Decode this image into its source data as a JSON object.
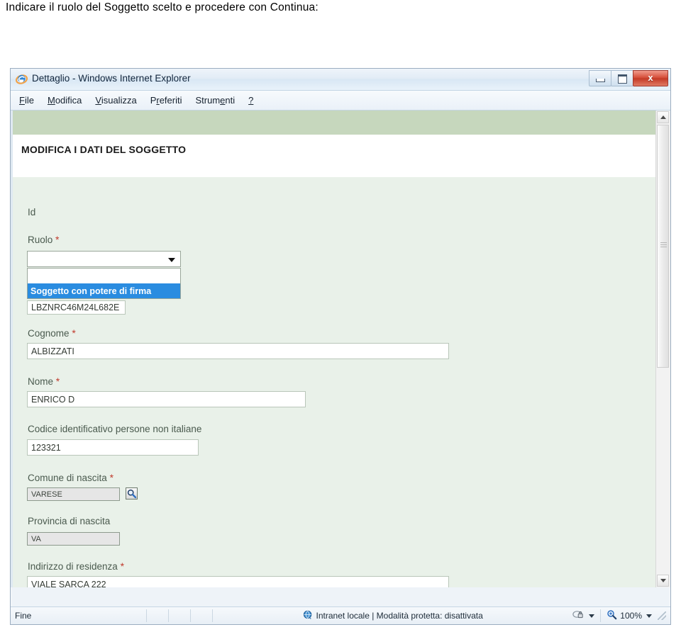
{
  "caption": "Indicare il ruolo del Soggetto scelto e procedere con Continua:",
  "window": {
    "title": "Dettaglio - Windows Internet Explorer",
    "icon": "internet-explorer-icon",
    "controls": {
      "minimize": "minimize-icon",
      "maximize": "maximize-icon",
      "close": "x"
    }
  },
  "menu": [
    {
      "pre": "",
      "accel": "F",
      "post": "ile"
    },
    {
      "pre": "",
      "accel": "M",
      "post": "odifica"
    },
    {
      "pre": "",
      "accel": "V",
      "post": "isualizza"
    },
    {
      "pre": "P",
      "accel": "r",
      "post": "eferiti"
    },
    {
      "pre": "Strum",
      "accel": "e",
      "post": "nti"
    },
    {
      "pre": "",
      "accel": "?",
      "post": ""
    }
  ],
  "form": {
    "title": "MODIFICA I DATI DEL SOGGETTO",
    "id_label": "Id",
    "ruolo": {
      "label": "Ruolo",
      "required": "*",
      "selected_value": "",
      "options": [
        "",
        "Soggetto con potere di firma"
      ],
      "highlighted_option": "Soggetto con potere di firma"
    },
    "codice_fiscale": {
      "value": "LBZNRC46M24L682E"
    },
    "cognome": {
      "label": "Cognome",
      "required": "*",
      "value": "ALBIZZATI"
    },
    "nome": {
      "label": "Nome",
      "required": "*",
      "value": "ENRICO D"
    },
    "codice_non_italiane": {
      "label": "Codice identificativo persone non italiane",
      "value": "123321"
    },
    "comune_nascita": {
      "label": "Comune di nascita",
      "required": "*",
      "value": "VARESE",
      "lookup_icon": "magnifier-icon"
    },
    "provincia_nascita": {
      "label": "Provincia di nascita",
      "value": "VA"
    },
    "indirizzo_residenza": {
      "label": "Indirizzo di residenza",
      "required": "*",
      "value": "VIALE SARCA 222"
    }
  },
  "statusbar": {
    "left": "Fine",
    "zone_icon": "globe-icon",
    "zone_text": "Intranet locale | Modalità protetta: disattivata",
    "privacy_icon": "privacy-report-icon",
    "zoom_icon": "magnifier-plus-icon",
    "zoom_level": "100%"
  },
  "colors": {
    "band_green": "#c6d7bd",
    "form_bg": "#e9f1e9",
    "highlight_blue": "#2a8ce0",
    "required_red": "#c0392b"
  }
}
